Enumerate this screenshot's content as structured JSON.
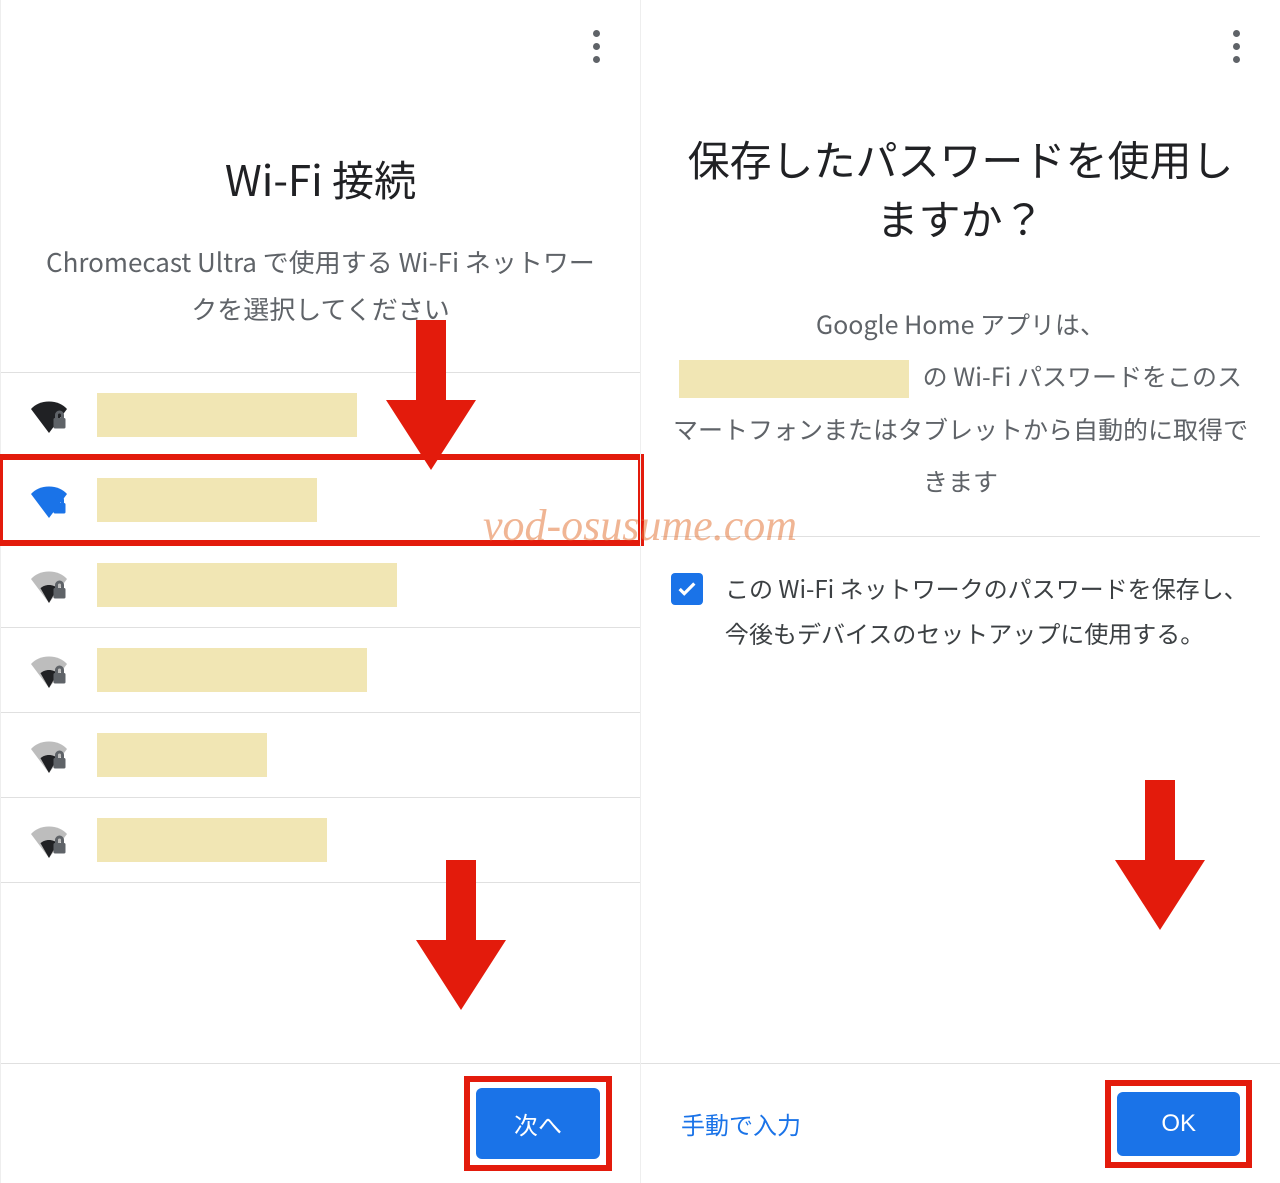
{
  "left": {
    "title": "Wi-Fi 接続",
    "subtitle": "Chromecast Ultra で使用する Wi-Fi ネットワークを選択してください",
    "networks": [
      {
        "signal": "strong",
        "selected": false
      },
      {
        "signal": "strong",
        "selected": true
      },
      {
        "signal": "weak",
        "selected": false
      },
      {
        "signal": "weak",
        "selected": false
      },
      {
        "signal": "weak",
        "selected": false
      },
      {
        "signal": "weak",
        "selected": false
      }
    ],
    "next_label": "次へ"
  },
  "right": {
    "title": "保存したパスワードを使用しますか？",
    "body_pre": "Google Home アプリは、",
    "body_mid": "の Wi-Fi パスワードをこのスマートフォンまたはタブレットから自動的に取得できます",
    "checkbox_label": "この Wi-Fi ネットワークのパスワードを保存し、今後もデバイスのセットアップに使用する。",
    "manual_label": "手動で入力",
    "ok_label": "OK"
  },
  "watermark": "vod-osusume.com"
}
